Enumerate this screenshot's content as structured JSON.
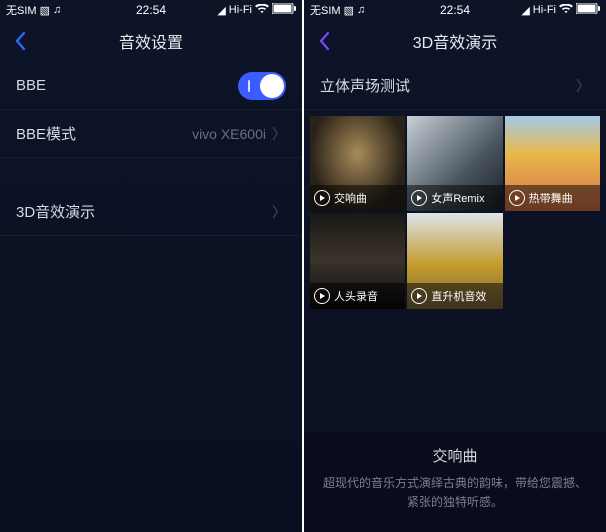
{
  "status": {
    "carrier": "无SIM",
    "time": "22:54",
    "hifi": "Hi-Fi"
  },
  "left": {
    "title": "音效设置",
    "rows": {
      "bbe": {
        "label": "BBE"
      },
      "bbeMode": {
        "label": "BBE模式",
        "value": "vivo XE600i"
      },
      "demo": {
        "label": "3D音效演示"
      }
    }
  },
  "right": {
    "title": "3D音效演示",
    "testRow": {
      "label": "立体声场测试"
    },
    "tiles": [
      {
        "label": "交响曲",
        "bg": "bg-orchestra"
      },
      {
        "label": "女声Remix",
        "bg": "bg-singer"
      },
      {
        "label": "热带舞曲",
        "bg": "bg-tropical"
      },
      {
        "label": "人头录音",
        "bg": "bg-vocal"
      },
      {
        "label": "直升机音效",
        "bg": "bg-heli"
      }
    ],
    "footer": {
      "title": "交响曲",
      "desc": "超现代的音乐方式演绎古典的韵味，带给您震撼、紧张的独特听感。"
    }
  }
}
